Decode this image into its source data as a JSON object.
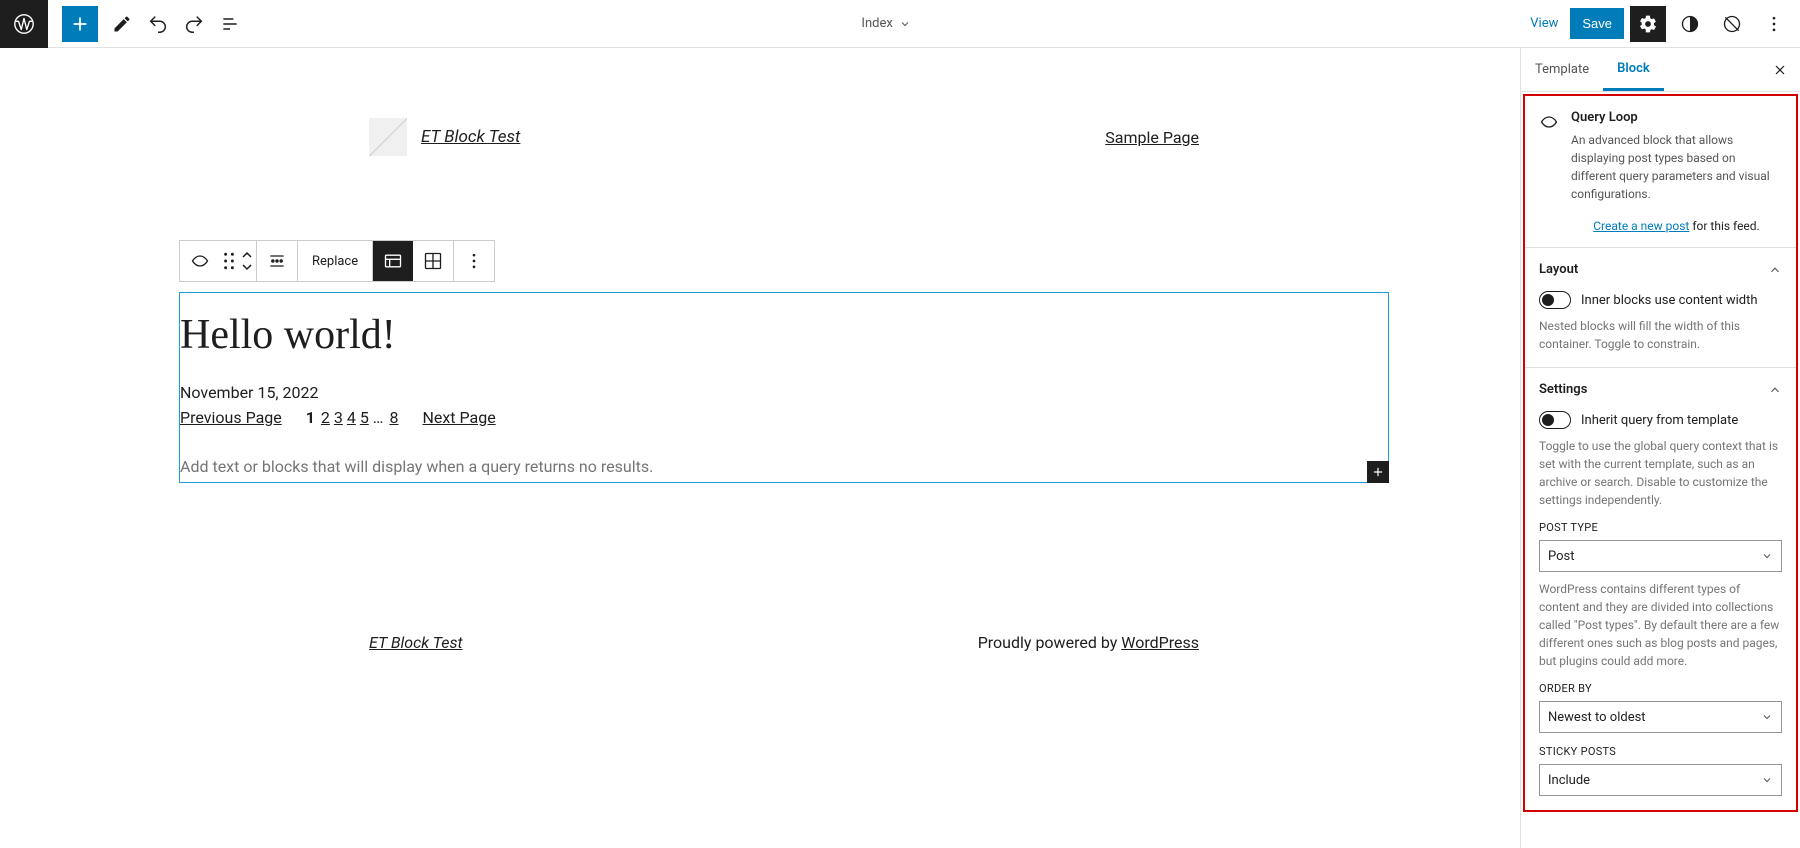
{
  "topbar": {
    "document_title": "Index",
    "view": "View",
    "save": "Save"
  },
  "editor": {
    "site_title": "ET Block Test",
    "nav_item": "Sample Page",
    "block_toolbar": {
      "replace": "Replace"
    },
    "post": {
      "title": "Hello world!",
      "date": "November 15, 2022"
    },
    "pagination": {
      "prev": "Previous Page",
      "next": "Next Page",
      "pages": [
        "1",
        "2",
        "3",
        "4",
        "5",
        "…",
        "8"
      ]
    },
    "no_results_placeholder": "Add text or blocks that will display when a query returns no results.",
    "footer": {
      "site_title": "ET Block Test",
      "powered_prefix": "Proudly powered by ",
      "powered_link": "WordPress"
    }
  },
  "sidebar": {
    "tab_template": "Template",
    "tab_block": "Block",
    "block": {
      "title": "Query Loop",
      "description": "An advanced block that allows displaying post types based on different query parameters and visual configurations.",
      "create_link": "Create a new post",
      "create_suffix": " for this feed."
    },
    "panel_layout": {
      "title": "Layout",
      "toggle_label": "Inner blocks use content width",
      "help": "Nested blocks will fill the width of this container. Toggle to constrain."
    },
    "panel_settings": {
      "title": "Settings",
      "toggle_label": "Inherit query from template",
      "help": "Toggle to use the global query context that is set with the current template, such as an archive or search. Disable to customize the settings independently.",
      "post_type_label": "POST TYPE",
      "post_type_value": "Post",
      "post_type_help": "WordPress contains different types of content and they are divided into collections called \"Post types\". By default there are a few different ones such as blog posts and pages, but plugins could add more.",
      "order_by_label": "ORDER BY",
      "order_by_value": "Newest to oldest",
      "sticky_label": "STICKY POSTS",
      "sticky_value": "Include"
    }
  }
}
